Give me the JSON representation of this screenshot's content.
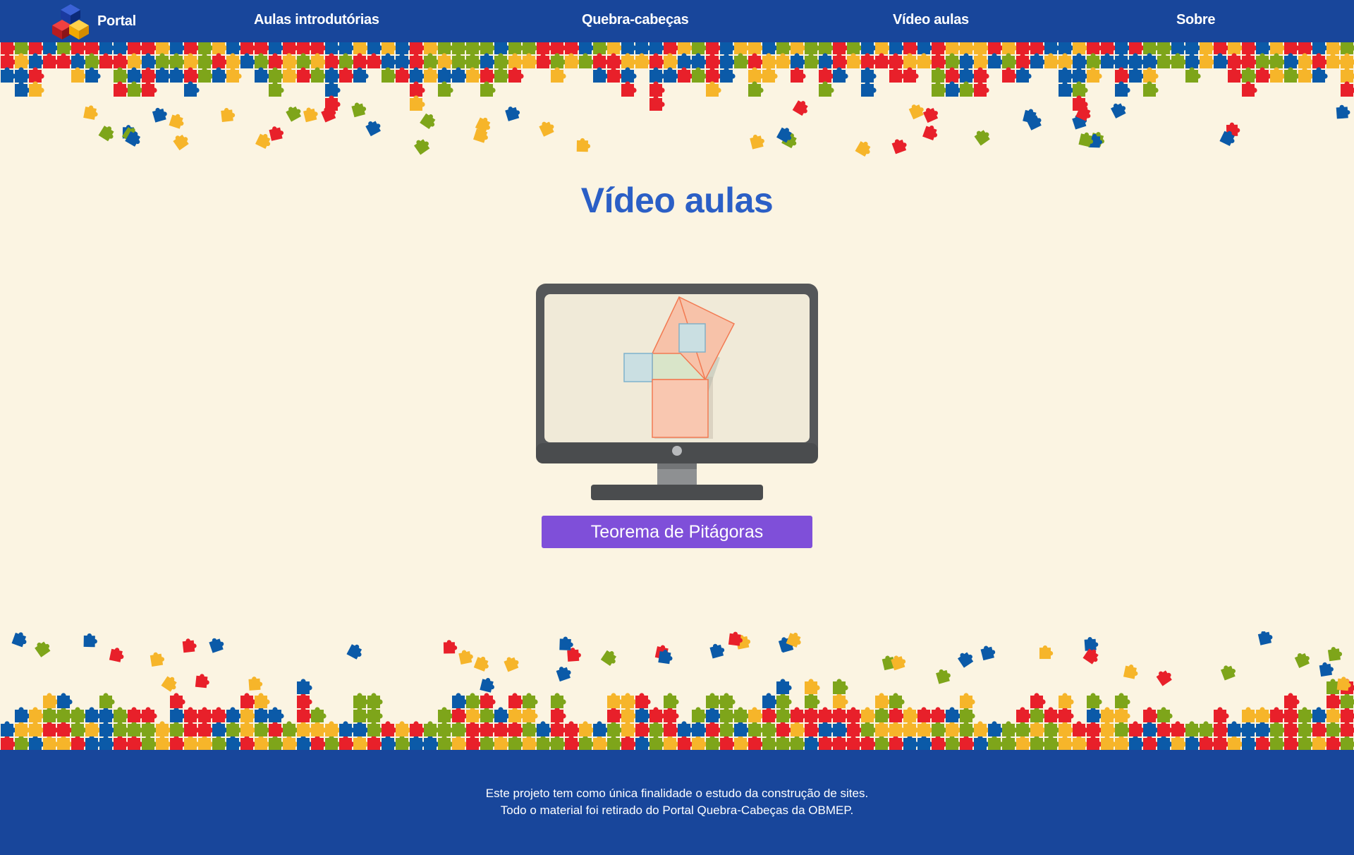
{
  "nav": {
    "brand_label": "Portal",
    "links": [
      "Aulas introdutórias",
      "Quebra-cabeças",
      "Vídeo aulas",
      "Sobre"
    ]
  },
  "main": {
    "title": "Vídeo aulas",
    "video_button_label": "Teorema de Pitágoras"
  },
  "footer": {
    "line1": "Este projeto tem como única finalidade o estudo da construção de sites.",
    "line2": "Todo o material foi retirado do Portal Quebra-Cabeças da OBMEP."
  },
  "colors": {
    "nav_bg": "#18469b",
    "page_bg": "#fbf4e2",
    "title": "#2b5fc6",
    "button": "#7f4fd9",
    "puzzle": [
      "#e8202a",
      "#0b5aa8",
      "#f6b52a",
      "#7ea51a"
    ]
  },
  "icons": {
    "logo": "stacked-cubes-logo-icon",
    "monitor": "monitor-icon",
    "diagram": "pythagoras-diagram-icon"
  }
}
